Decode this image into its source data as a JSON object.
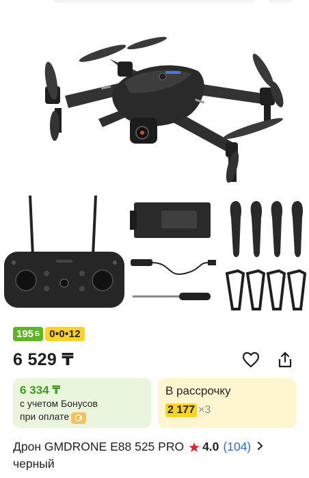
{
  "badges": {
    "bonus_value": "195",
    "bonus_currency": "Б",
    "installment": "0•0•12"
  },
  "price": {
    "main": "6 529 ₸"
  },
  "bonus_card": {
    "price": "6 334 ₸",
    "line1": "с учетом Бонусов",
    "line2": "при оплате"
  },
  "installment_card": {
    "title": "В рассрочку",
    "amount": "2 177",
    "multiplier": "×3"
  },
  "product": {
    "title": "Дрон GMDRONE E88 525 PRO",
    "title_line2": "черный",
    "rating": "4.0",
    "reviews": "(104)"
  },
  "icons": {
    "favorite": "heart-icon",
    "share": "share-icon",
    "star": "star-icon",
    "chevron": "chevron-right-icon",
    "coin": "kaspi-coin-icon"
  },
  "colors": {
    "bonus_green": "#5fb526",
    "installment_yellow": "#ffd320",
    "link_blue": "#2b6cd3",
    "star_red": "#e3252b"
  }
}
